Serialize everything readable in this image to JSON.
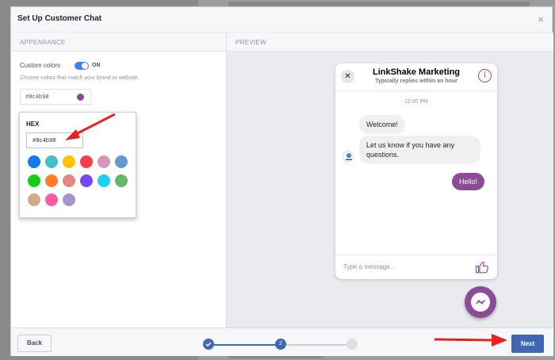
{
  "modal": {
    "title": "Set Up Customer Chat",
    "close_glyph": "×"
  },
  "appearance": {
    "section_label": "APPEARANCE",
    "custom_colors_label": "Custom colors",
    "toggle_state": "ON",
    "helper_text": "Choose colors that match your brand or website.",
    "hex_value": "#8c4b98",
    "picker": {
      "label": "HEX",
      "input_value": "#8c4b98",
      "swatches": [
        "#1877f2",
        "#44bec7",
        "#ffc300",
        "#fa3c4c",
        "#d696bb",
        "#6699cc",
        "#13cf13",
        "#ff7e29",
        "#e68585",
        "#7646ff",
        "#20cef5",
        "#67b868",
        "#d4a88c",
        "#ff5ca1",
        "#a695c7"
      ]
    }
  },
  "preview": {
    "section_label": "PREVIEW",
    "page_name": "LinkShake Marketing",
    "reply_time": "Typically replies within an hour",
    "close_glyph": "✕",
    "info_glyph": "i",
    "timestamp": "12:00 PM",
    "messages_in": [
      "Welcome!",
      "Let us know if you have any questions."
    ],
    "message_out": "Hello!",
    "input_placeholder": "Type a message...",
    "accent_color": "#8c4b98"
  },
  "footer": {
    "back_label": "Back",
    "next_label": "Next",
    "steps": [
      "",
      "2",
      ""
    ]
  }
}
